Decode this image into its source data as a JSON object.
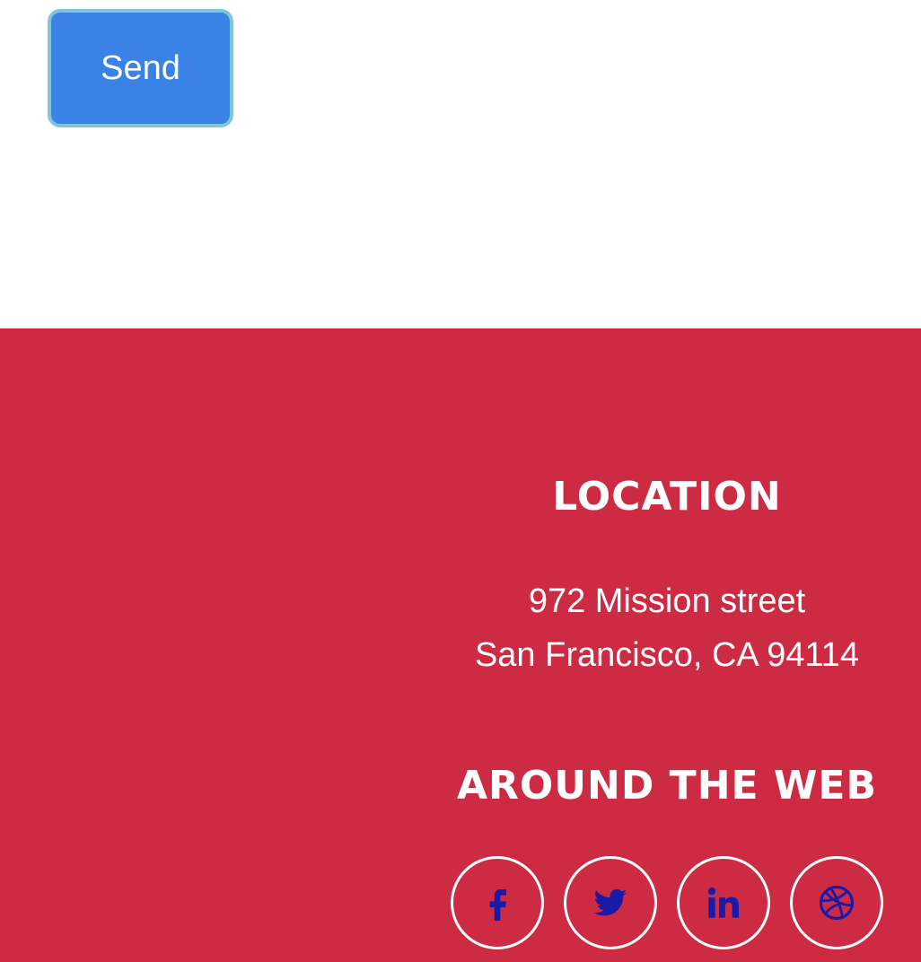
{
  "form": {
    "send_label": "Send"
  },
  "footer": {
    "location": {
      "heading": "LOCATION",
      "address_line1": "972 Mission street",
      "address_line2": "San Francisco, CA 94114"
    },
    "around_the_web": {
      "heading": "AROUND THE WEB",
      "links": [
        {
          "icon": "facebook-icon"
        },
        {
          "icon": "twitter-icon"
        },
        {
          "icon": "linkedin-icon"
        },
        {
          "icon": "dribbble-icon"
        }
      ]
    }
  },
  "colors": {
    "footer_background": "#cc2b43",
    "send_button": "#3b82e6",
    "send_button_border": "#7ec7d8",
    "social_icon": "#1a1aa8",
    "text_light": "#ffffff"
  }
}
